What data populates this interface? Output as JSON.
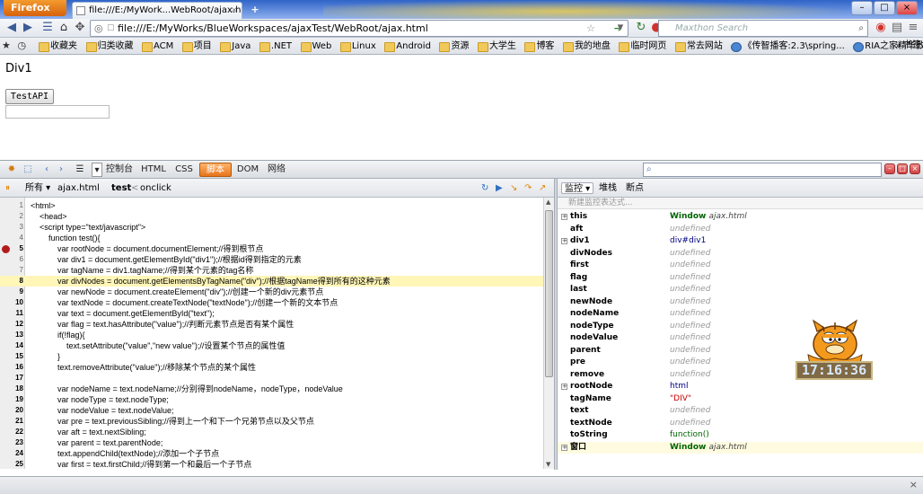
{
  "browser": {
    "menu_button": "Firefox",
    "tab_title": "file:///E:/MyWork...WebRoot/ajax.html",
    "url": "file:///E:/MyWorks/BlueWorkspaces/ajaxTest/WebRoot/ajax.html",
    "search_placeholder": "Maxthon Search",
    "bookmarks_label": "书签",
    "bookmarks": [
      "收藏夹",
      "归类收藏",
      "ACM",
      "项目",
      "Java",
      ".NET",
      "Web",
      "Linux",
      "Android",
      "资源",
      "大学生",
      "博客",
      "我的地盘",
      "临时网页",
      "常去网站",
      "《传智播客:2.3\\spring...",
      "RIA之家精华教程和资..."
    ]
  },
  "page": {
    "heading": "Div1",
    "button_label": "TestAPI",
    "text_input_value": ""
  },
  "firebug": {
    "tabs": [
      "控制台",
      "HTML",
      "CSS",
      "脚本",
      "DOM",
      "网络"
    ],
    "selected_tab": "脚本",
    "script_bar": {
      "filter": "所有",
      "file": "ajax.html",
      "breadcrumb_current": "test",
      "breadcrumb_sep": "<",
      "breadcrumb_parent": "onclick"
    },
    "code_lines": [
      {
        "num": "1",
        "text": "<html>"
      },
      {
        "num": "2",
        "text": "    <head>"
      },
      {
        "num": "3",
        "text": "    <script type=\"text/javascript\">"
      },
      {
        "num": "4",
        "text": "        function test(){"
      },
      {
        "num": "5",
        "text": "            var rootNode = document.documentElement;//得到根节点",
        "breakpoint": true
      },
      {
        "num": "6",
        "text": "            var div1 = document.getElementById(\"div1\");//根据id得到指定的元素"
      },
      {
        "num": "7",
        "text": "            var tagName = div1.tagName;//得到某个元素的tag名称"
      },
      {
        "num": "8",
        "text": "            var divNodes = document.getElementsByTagName(\"div\");//根据tagName得到所有的这种元素",
        "current": true
      },
      {
        "num": "9",
        "text": "            var newNode = document.createElement(\"div\");//创建一个新的div元素节点"
      },
      {
        "num": "10",
        "text": "            var textNode = document.createTextNode(\"textNode\");//创建一个新的文本节点"
      },
      {
        "num": "11",
        "text": "            var text = document.getElementById(\"text\");"
      },
      {
        "num": "12",
        "text": "            var flag = text.hasAttribute(\"value\");//判断元素节点是否有某个属性"
      },
      {
        "num": "13",
        "text": "            if(!flag){"
      },
      {
        "num": "14",
        "text": "                text.setAttribute(\"value\",\"new value\");//设置某个节点的属性值"
      },
      {
        "num": "15",
        "text": "            }"
      },
      {
        "num": "16",
        "text": "            text.removeAttribute(\"value\");//移除某个节点的某个属性"
      },
      {
        "num": "17",
        "text": ""
      },
      {
        "num": "18",
        "text": "            var nodeName = text.nodeName;//分别得到nodeName，nodeType，nodeValue"
      },
      {
        "num": "19",
        "text": "            var nodeType = text.nodeType;"
      },
      {
        "num": "20",
        "text": "            var nodeValue = text.nodeValue;"
      },
      {
        "num": "21",
        "text": "            var pre = text.previousSibling;//得到上一个和下一个兄弟节点以及父节点"
      },
      {
        "num": "22",
        "text": "            var aft = text.nextSibling;"
      },
      {
        "num": "23",
        "text": "            var parent = text.parentNode;"
      },
      {
        "num": "24",
        "text": "            text.appendChild(textNode);//添加一个子节点"
      },
      {
        "num": "25",
        "text": "            var first = text.firstChild;//得到第一个和最后一个子节点"
      }
    ],
    "side_tabs": [
      "监控",
      "堆栈",
      "断点"
    ],
    "new_watch_placeholder": "新建监控表达式...",
    "watch": [
      {
        "name": "this",
        "value": "Window",
        "extra": "ajax.html",
        "kind": "obj",
        "expand": true
      },
      {
        "name": "aft",
        "value": "undefined",
        "kind": "undef"
      },
      {
        "name": "div1",
        "value": "div#div1",
        "kind": "el",
        "expand": true
      },
      {
        "name": "divNodes",
        "value": "undefined",
        "kind": "undef"
      },
      {
        "name": "first",
        "value": "undefined",
        "kind": "undef"
      },
      {
        "name": "flag",
        "value": "undefined",
        "kind": "undef"
      },
      {
        "name": "last",
        "value": "undefined",
        "kind": "undef"
      },
      {
        "name": "newNode",
        "value": "undefined",
        "kind": "undef"
      },
      {
        "name": "nodeName",
        "value": "undefined",
        "kind": "undef"
      },
      {
        "name": "nodeType",
        "value": "undefined",
        "kind": "undef"
      },
      {
        "name": "nodeValue",
        "value": "undefined",
        "kind": "undef"
      },
      {
        "name": "parent",
        "value": "undefined",
        "kind": "undef"
      },
      {
        "name": "pre",
        "value": "undefined",
        "kind": "undef"
      },
      {
        "name": "remove",
        "value": "undefined",
        "kind": "undef"
      },
      {
        "name": "rootNode",
        "value": "html",
        "kind": "el",
        "expand": true
      },
      {
        "name": "tagName",
        "value": "\"DIV\"",
        "kind": "str"
      },
      {
        "name": "text",
        "value": "undefined",
        "kind": "undef"
      },
      {
        "name": "textNode",
        "value": "undefined",
        "kind": "undef"
      },
      {
        "name": "toString",
        "value": "function()",
        "kind": "fn"
      },
      {
        "name": "窗口",
        "value": "Window",
        "extra": "ajax.html",
        "kind": "obj",
        "expand": true,
        "hl": true
      }
    ]
  },
  "widget": {
    "clock_time": "17:16:36"
  }
}
